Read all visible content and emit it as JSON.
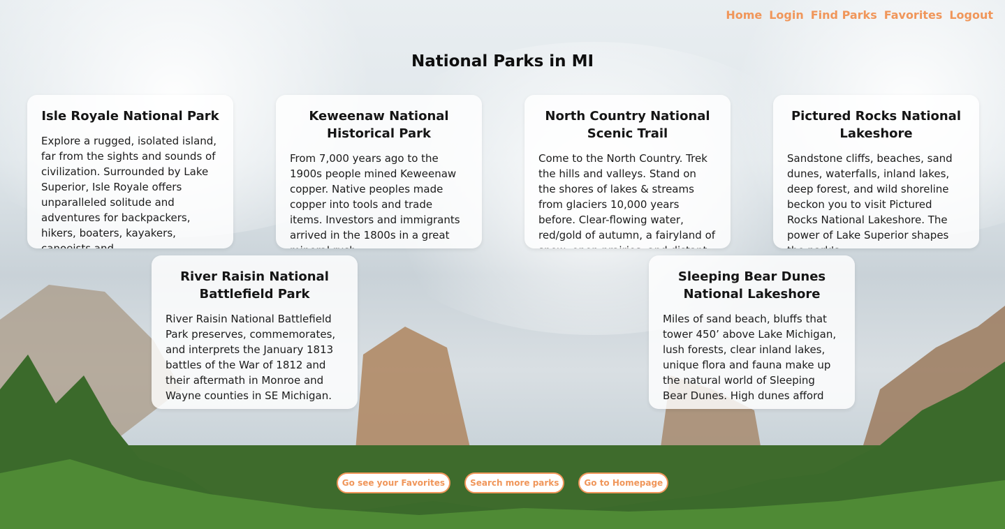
{
  "nav": {
    "items": [
      "Home",
      "Login",
      "Find Parks",
      "Favorites",
      "Logout"
    ]
  },
  "page_title": "National Parks in MI",
  "parks": [
    {
      "name": "Isle Royale National Park",
      "description": "Explore a rugged, isolated island, far from the sights and sounds of civilization. Surrounded by Lake Superior, Isle Royale offers unparalleled solitude and adventures for backpackers, hikers, boaters, kayakers, canoeists and"
    },
    {
      "name": "Keweenaw National Historical Park",
      "description": "From 7,000 years ago to the 1900s people mined Keweenaw copper. Native peoples made copper into tools and trade items. Investors and immigrants arrived in the 1800s in a great mineral rush,"
    },
    {
      "name": "North Country National Scenic Trail",
      "description": "Come to the North Country. Trek the hills and valleys. Stand on the shores of lakes & streams from glaciers 10,000 years before. Clear-flowing water, red/gold of autumn, a fairyland of snow, open prairies, and distant"
    },
    {
      "name": "Pictured Rocks National Lakeshore",
      "description": "Sandstone cliffs, beaches, sand dunes, waterfalls, inland lakes, deep forest, and wild shoreline beckon you to visit Pictured Rocks National Lakeshore. The power of Lake Superior shapes the park's"
    },
    {
      "name": "River Raisin National Battlefield Park",
      "description": "River Raisin National Battlefield Park preserves, commemorates, and interprets the January 1813 battles of the War of 1812 and their aftermath in Monroe and Wayne counties in SE Michigan."
    },
    {
      "name": "Sleeping Bear Dunes National Lakeshore",
      "description": "Miles of sand beach, bluffs that tower 450’ above Lake Michigan, lush forests, clear inland lakes, unique flora and fauna make up the natural world of Sleeping Bear Dunes. High dunes afford"
    }
  ],
  "buttons": {
    "favorites": "Go see your Favorites",
    "search": "Search more parks",
    "home": "Go to Homepage"
  },
  "colors": {
    "accent": "#f0965a"
  }
}
